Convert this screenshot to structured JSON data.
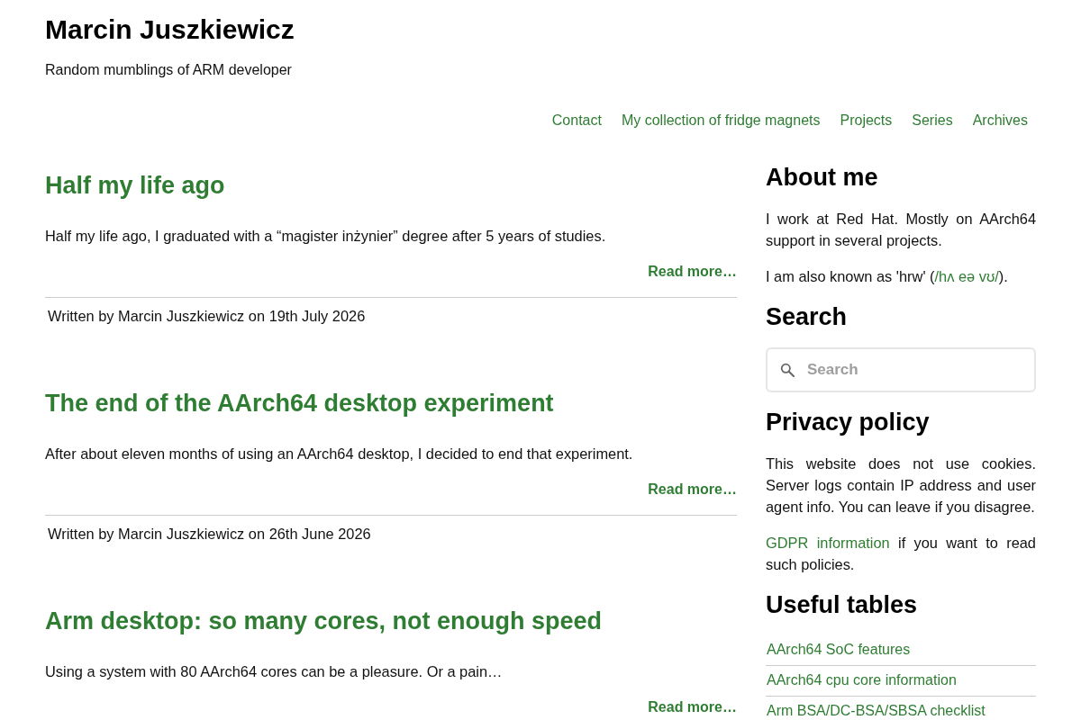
{
  "site": {
    "title": "Marcin Juszkiewicz",
    "tagline": "Random mumblings of ARM developer"
  },
  "nav": [
    "Contact",
    "My collection of fridge magnets",
    "Projects",
    "Series",
    "Archives"
  ],
  "posts": [
    {
      "title": "Half my life ago",
      "excerpt": "Half my life ago, I graduated with a “magister inżynier” degree after 5 years of studies.",
      "read_more": "Read more…",
      "byline": "Written by Marcin Juszkiewicz on 19th July 2026"
    },
    {
      "title": "The end of the AArch64 desktop experiment",
      "excerpt": "After about eleven months of using an AArch64 desktop, I decided to end that experiment.",
      "read_more": "Read more…",
      "byline": "Written by Marcin Juszkiewicz on 26th June 2026"
    },
    {
      "title": "Arm desktop: so many cores, not enough speed",
      "excerpt": "Using a system with 80 AArch64 cores can be a pleasure. Or a pain…",
      "read_more": "Read more…"
    }
  ],
  "sidebar": [
    {
      "kind": "text",
      "heading": "About me",
      "paragraphs": [
        [
          {
            "text": "I work at Red Hat. Mostly on AArch64 support in several projects."
          }
        ],
        [
          {
            "text": "I am also known as 'hrw' ("
          },
          {
            "link": "/hʌ eə vʊ/"
          },
          {
            "text": ")."
          }
        ]
      ]
    },
    {
      "kind": "search",
      "heading": "Search",
      "placeholder": "Search"
    },
    {
      "kind": "text",
      "heading": "Privacy policy",
      "paragraphs": [
        [
          {
            "text": "This website does not use cookies. Server logs contain IP address and user agent info. You can leave if you disagree."
          }
        ],
        [
          {
            "link": "GDPR information"
          },
          {
            "text": " if you want to read such policies."
          }
        ]
      ]
    },
    {
      "kind": "links",
      "heading": "Useful tables",
      "links": [
        "AArch64 SoC features",
        "AArch64 cpu core information",
        "Arm BSA/DC-BSA/SBSA checklist"
      ]
    }
  ]
}
